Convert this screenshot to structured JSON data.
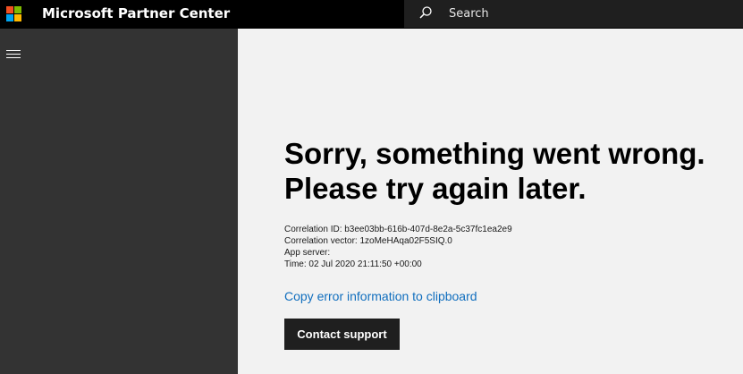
{
  "header": {
    "app_title": "Microsoft Partner Center",
    "logo_icon": "microsoft-logo",
    "search": {
      "placeholder": "Search",
      "icon": "search-icon"
    }
  },
  "sidebar": {
    "menu_icon": "hamburger-menu-icon"
  },
  "error": {
    "heading_line1": "Sorry, something went wrong.",
    "heading_line2": "Please try again later.",
    "correlation_id": "Correlation ID: b3ee03bb-616b-407d-8e2a-5c37fc1ea2e9",
    "correlation_vector": "Correlation vector: 1zoMeHAqa02F5SIQ.0",
    "app_server": "App server:",
    "time": "Time: 02 Jul 2020 21:11:50 +00:00",
    "copy_link": "Copy error information to clipboard",
    "contact_button": "Contact support"
  },
  "colors": {
    "topbar": "#000000",
    "sidebar": "#333333",
    "content_background": "#f2f2f2",
    "link": "#106ebe",
    "button": "#1f1f1f",
    "logo_red": "#f25022",
    "logo_green": "#7fba00",
    "logo_blue": "#00a4ef",
    "logo_yellow": "#ffb900"
  }
}
